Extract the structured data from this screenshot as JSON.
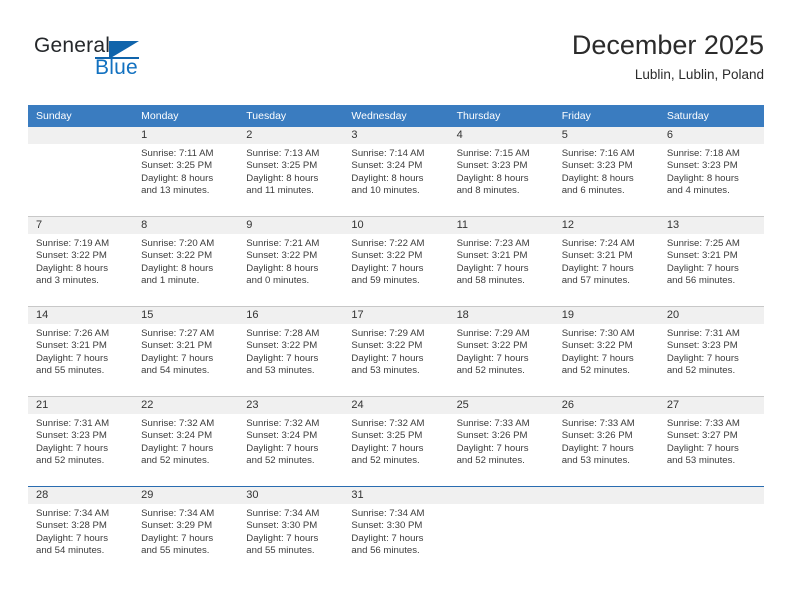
{
  "brand": {
    "name_top": "General",
    "name_bottom": "Blue",
    "accent_color": "#1064ab",
    "logo_icon": "triangle-flag-icon"
  },
  "header": {
    "title": "December 2025",
    "subtitle": "Lublin, Lublin, Poland"
  },
  "theme": {
    "header_row_bg": "#3a7cc0",
    "daynum_band_bg": "#f0f0f0",
    "grid_line": "#c8c8c8",
    "last_row_border": "#2a6cb0"
  },
  "weekday_headers": [
    "Sunday",
    "Monday",
    "Tuesday",
    "Wednesday",
    "Thursday",
    "Friday",
    "Saturday"
  ],
  "weeks": [
    [
      {
        "day": "",
        "sunrise": "",
        "sunset": "",
        "daylight_line1": "",
        "daylight_line2": ""
      },
      {
        "day": "1",
        "sunrise": "Sunrise: 7:11 AM",
        "sunset": "Sunset: 3:25 PM",
        "daylight_line1": "Daylight: 8 hours",
        "daylight_line2": "and 13 minutes."
      },
      {
        "day": "2",
        "sunrise": "Sunrise: 7:13 AM",
        "sunset": "Sunset: 3:25 PM",
        "daylight_line1": "Daylight: 8 hours",
        "daylight_line2": "and 11 minutes."
      },
      {
        "day": "3",
        "sunrise": "Sunrise: 7:14 AM",
        "sunset": "Sunset: 3:24 PM",
        "daylight_line1": "Daylight: 8 hours",
        "daylight_line2": "and 10 minutes."
      },
      {
        "day": "4",
        "sunrise": "Sunrise: 7:15 AM",
        "sunset": "Sunset: 3:23 PM",
        "daylight_line1": "Daylight: 8 hours",
        "daylight_line2": "and 8 minutes."
      },
      {
        "day": "5",
        "sunrise": "Sunrise: 7:16 AM",
        "sunset": "Sunset: 3:23 PM",
        "daylight_line1": "Daylight: 8 hours",
        "daylight_line2": "and 6 minutes."
      },
      {
        "day": "6",
        "sunrise": "Sunrise: 7:18 AM",
        "sunset": "Sunset: 3:23 PM",
        "daylight_line1": "Daylight: 8 hours",
        "daylight_line2": "and 4 minutes."
      }
    ],
    [
      {
        "day": "7",
        "sunrise": "Sunrise: 7:19 AM",
        "sunset": "Sunset: 3:22 PM",
        "daylight_line1": "Daylight: 8 hours",
        "daylight_line2": "and 3 minutes."
      },
      {
        "day": "8",
        "sunrise": "Sunrise: 7:20 AM",
        "sunset": "Sunset: 3:22 PM",
        "daylight_line1": "Daylight: 8 hours",
        "daylight_line2": "and 1 minute."
      },
      {
        "day": "9",
        "sunrise": "Sunrise: 7:21 AM",
        "sunset": "Sunset: 3:22 PM",
        "daylight_line1": "Daylight: 8 hours",
        "daylight_line2": "and 0 minutes."
      },
      {
        "day": "10",
        "sunrise": "Sunrise: 7:22 AM",
        "sunset": "Sunset: 3:22 PM",
        "daylight_line1": "Daylight: 7 hours",
        "daylight_line2": "and 59 minutes."
      },
      {
        "day": "11",
        "sunrise": "Sunrise: 7:23 AM",
        "sunset": "Sunset: 3:21 PM",
        "daylight_line1": "Daylight: 7 hours",
        "daylight_line2": "and 58 minutes."
      },
      {
        "day": "12",
        "sunrise": "Sunrise: 7:24 AM",
        "sunset": "Sunset: 3:21 PM",
        "daylight_line1": "Daylight: 7 hours",
        "daylight_line2": "and 57 minutes."
      },
      {
        "day": "13",
        "sunrise": "Sunrise: 7:25 AM",
        "sunset": "Sunset: 3:21 PM",
        "daylight_line1": "Daylight: 7 hours",
        "daylight_line2": "and 56 minutes."
      }
    ],
    [
      {
        "day": "14",
        "sunrise": "Sunrise: 7:26 AM",
        "sunset": "Sunset: 3:21 PM",
        "daylight_line1": "Daylight: 7 hours",
        "daylight_line2": "and 55 minutes."
      },
      {
        "day": "15",
        "sunrise": "Sunrise: 7:27 AM",
        "sunset": "Sunset: 3:21 PM",
        "daylight_line1": "Daylight: 7 hours",
        "daylight_line2": "and 54 minutes."
      },
      {
        "day": "16",
        "sunrise": "Sunrise: 7:28 AM",
        "sunset": "Sunset: 3:22 PM",
        "daylight_line1": "Daylight: 7 hours",
        "daylight_line2": "and 53 minutes."
      },
      {
        "day": "17",
        "sunrise": "Sunrise: 7:29 AM",
        "sunset": "Sunset: 3:22 PM",
        "daylight_line1": "Daylight: 7 hours",
        "daylight_line2": "and 53 minutes."
      },
      {
        "day": "18",
        "sunrise": "Sunrise: 7:29 AM",
        "sunset": "Sunset: 3:22 PM",
        "daylight_line1": "Daylight: 7 hours",
        "daylight_line2": "and 52 minutes."
      },
      {
        "day": "19",
        "sunrise": "Sunrise: 7:30 AM",
        "sunset": "Sunset: 3:22 PM",
        "daylight_line1": "Daylight: 7 hours",
        "daylight_line2": "and 52 minutes."
      },
      {
        "day": "20",
        "sunrise": "Sunrise: 7:31 AM",
        "sunset": "Sunset: 3:23 PM",
        "daylight_line1": "Daylight: 7 hours",
        "daylight_line2": "and 52 minutes."
      }
    ],
    [
      {
        "day": "21",
        "sunrise": "Sunrise: 7:31 AM",
        "sunset": "Sunset: 3:23 PM",
        "daylight_line1": "Daylight: 7 hours",
        "daylight_line2": "and 52 minutes."
      },
      {
        "day": "22",
        "sunrise": "Sunrise: 7:32 AM",
        "sunset": "Sunset: 3:24 PM",
        "daylight_line1": "Daylight: 7 hours",
        "daylight_line2": "and 52 minutes."
      },
      {
        "day": "23",
        "sunrise": "Sunrise: 7:32 AM",
        "sunset": "Sunset: 3:24 PM",
        "daylight_line1": "Daylight: 7 hours",
        "daylight_line2": "and 52 minutes."
      },
      {
        "day": "24",
        "sunrise": "Sunrise: 7:32 AM",
        "sunset": "Sunset: 3:25 PM",
        "daylight_line1": "Daylight: 7 hours",
        "daylight_line2": "and 52 minutes."
      },
      {
        "day": "25",
        "sunrise": "Sunrise: 7:33 AM",
        "sunset": "Sunset: 3:26 PM",
        "daylight_line1": "Daylight: 7 hours",
        "daylight_line2": "and 52 minutes."
      },
      {
        "day": "26",
        "sunrise": "Sunrise: 7:33 AM",
        "sunset": "Sunset: 3:26 PM",
        "daylight_line1": "Daylight: 7 hours",
        "daylight_line2": "and 53 minutes."
      },
      {
        "day": "27",
        "sunrise": "Sunrise: 7:33 AM",
        "sunset": "Sunset: 3:27 PM",
        "daylight_line1": "Daylight: 7 hours",
        "daylight_line2": "and 53 minutes."
      }
    ],
    [
      {
        "day": "28",
        "sunrise": "Sunrise: 7:34 AM",
        "sunset": "Sunset: 3:28 PM",
        "daylight_line1": "Daylight: 7 hours",
        "daylight_line2": "and 54 minutes."
      },
      {
        "day": "29",
        "sunrise": "Sunrise: 7:34 AM",
        "sunset": "Sunset: 3:29 PM",
        "daylight_line1": "Daylight: 7 hours",
        "daylight_line2": "and 55 minutes."
      },
      {
        "day": "30",
        "sunrise": "Sunrise: 7:34 AM",
        "sunset": "Sunset: 3:30 PM",
        "daylight_line1": "Daylight: 7 hours",
        "daylight_line2": "and 55 minutes."
      },
      {
        "day": "31",
        "sunrise": "Sunrise: 7:34 AM",
        "sunset": "Sunset: 3:30 PM",
        "daylight_line1": "Daylight: 7 hours",
        "daylight_line2": "and 56 minutes."
      },
      {
        "day": "",
        "sunrise": "",
        "sunset": "",
        "daylight_line1": "",
        "daylight_line2": ""
      },
      {
        "day": "",
        "sunrise": "",
        "sunset": "",
        "daylight_line1": "",
        "daylight_line2": ""
      },
      {
        "day": "",
        "sunrise": "",
        "sunset": "",
        "daylight_line1": "",
        "daylight_line2": ""
      }
    ]
  ]
}
